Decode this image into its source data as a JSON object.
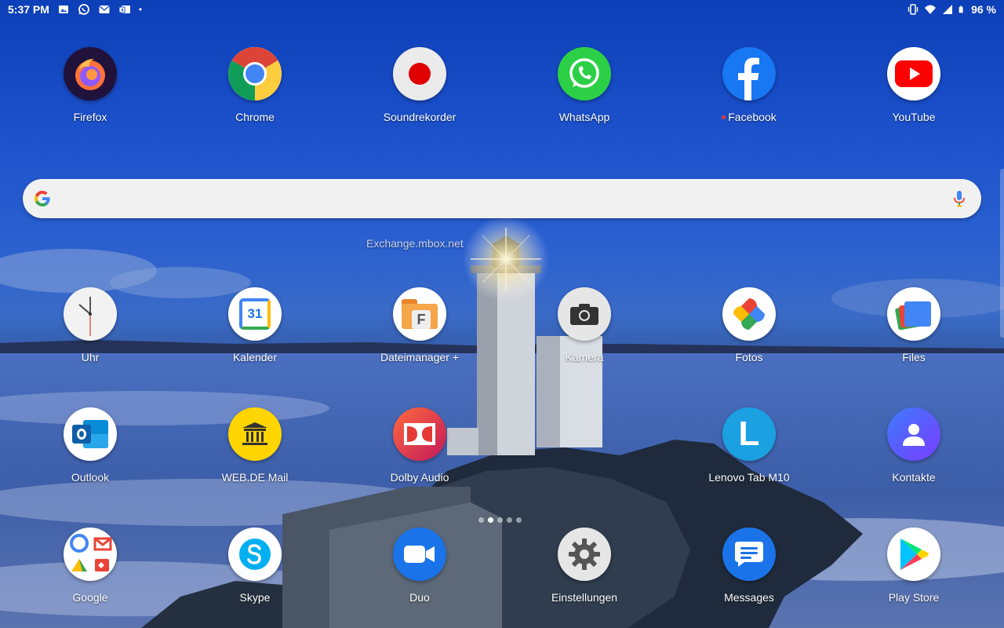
{
  "status_bar": {
    "time": "5:37 PM",
    "left_icons": [
      "image-icon",
      "whatsapp-icon",
      "mail-icon",
      "outlook-mail-icon"
    ],
    "more_dot": "•",
    "right_icons": [
      "vibrate-icon",
      "wifi-icon",
      "signal-icon",
      "battery-icon"
    ],
    "battery": "96 %"
  },
  "row1": [
    {
      "name": "firefox",
      "label": "Firefox"
    },
    {
      "name": "chrome",
      "label": "Chrome"
    },
    {
      "name": "soundrekorder",
      "label": "Soundrekorder"
    },
    {
      "name": "whatsapp",
      "label": "WhatsApp"
    },
    {
      "name": "facebook",
      "label": "Facebook",
      "notification": true
    },
    {
      "name": "youtube",
      "label": "YouTube"
    }
  ],
  "search": {
    "google_logo": "G",
    "mic": "mic-icon"
  },
  "widget": {
    "text": "Exchange.mbox.net"
  },
  "row2": [
    {
      "name": "uhr",
      "label": "Uhr"
    },
    {
      "name": "kalender",
      "label": "Kalender",
      "icon_text": "31"
    },
    {
      "name": "dateimanager",
      "label": "Dateimanager +",
      "icon_text": "F"
    },
    {
      "name": "kamera",
      "label": "Kamera"
    },
    {
      "name": "fotos",
      "label": "Fotos"
    },
    {
      "name": "files",
      "label": "Files"
    }
  ],
  "row3": [
    {
      "name": "outlook",
      "label": "Outlook"
    },
    {
      "name": "webde-mail",
      "label": "WEB.DE Mail"
    },
    {
      "name": "dolby-audio",
      "label": "Dolby Audio"
    },
    {
      "name": "lenovo-tab",
      "label": "Lenovo Tab M10",
      "icon_text": "L"
    },
    {
      "name": "kontakte",
      "label": "Kontakte"
    }
  ],
  "row4": [
    {
      "name": "google-folder",
      "label": "Google"
    },
    {
      "name": "skype",
      "label": "Skype"
    },
    {
      "name": "duo",
      "label": "Duo"
    },
    {
      "name": "einstellungen",
      "label": "Einstellungen"
    },
    {
      "name": "messages",
      "label": "Messages"
    },
    {
      "name": "play-store",
      "label": "Play Store"
    }
  ],
  "page_indicator": {
    "pages": 5,
    "current": 2
  }
}
